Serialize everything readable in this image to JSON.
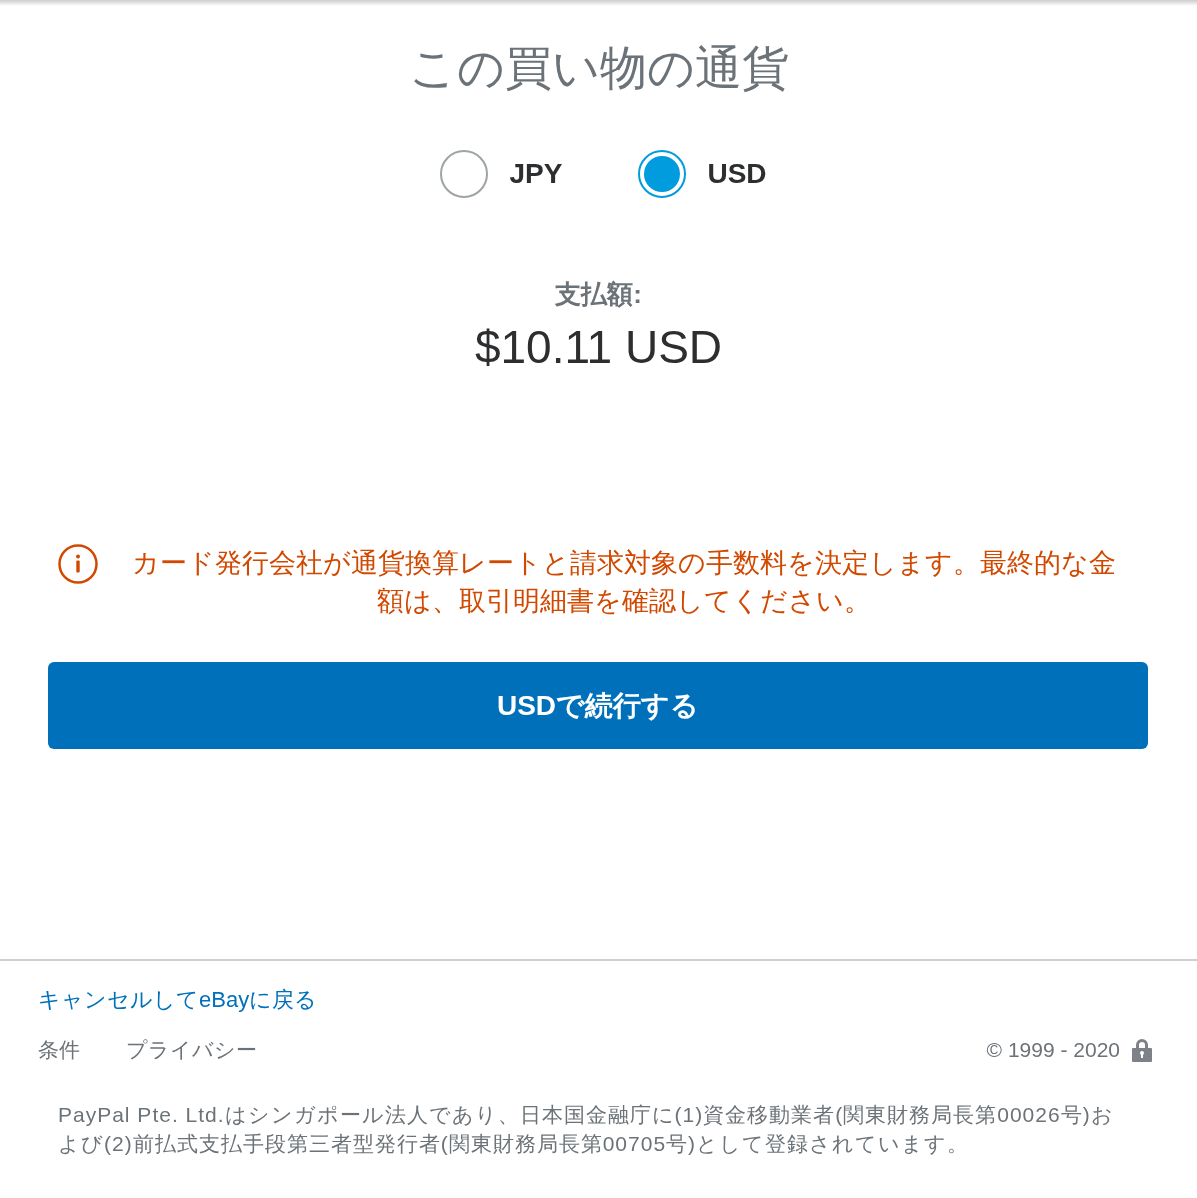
{
  "title": "この買い物の通貨",
  "currency_options": [
    {
      "label": "JPY",
      "selected": false
    },
    {
      "label": "USD",
      "selected": true
    }
  ],
  "payment": {
    "label": "支払額:",
    "amount": "$10.11 USD"
  },
  "notice": {
    "text": "カード発行会社が通貨換算レートと請求対象の手数料を決定します。最終的な金額は、取引明細書を確認してください。"
  },
  "continue_button": {
    "label": "USDで続行する"
  },
  "footer": {
    "cancel_link": "キャンセルしてeBayに戻る",
    "links": [
      "条件",
      "プライバシー"
    ],
    "copyright": "© 1999 - 2020",
    "legal": "PayPal Pte. Ltd.はシンガポール法人であり、日本国金融庁に(1)資金移動業者(関東財務局長第00026号)および(2)前払式支払手段第三者型発行者(関東財務局長第00705号)として登録されています。"
  }
}
